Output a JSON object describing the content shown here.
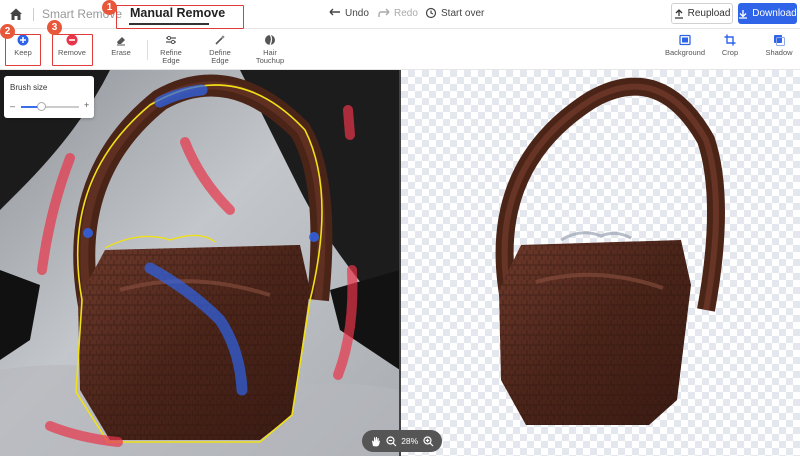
{
  "header": {
    "tab_smart": "Smart Remove",
    "tab_manual": "Manual Remove",
    "undo": "Undo",
    "redo": "Redo",
    "start_over": "Start over",
    "reupload": "Reupload",
    "download": "Download"
  },
  "toolbar": {
    "keep": "Keep",
    "remove": "Remove",
    "erase": "Erase",
    "refine_edge": [
      "Refine",
      "Edge"
    ],
    "define_edge": [
      "Define",
      "Edge"
    ],
    "hair_touchup": [
      "Hair",
      "Touchup"
    ],
    "background": "Background",
    "crop": "Crop",
    "shadow": "Shadow"
  },
  "brush": {
    "label": "Brush size",
    "minus": "–",
    "plus": "+",
    "level": 0.35
  },
  "zoom": {
    "value": "28%"
  },
  "annotations": [
    "1",
    "2",
    "3"
  ],
  "colors": {
    "accent": "#2f64e8",
    "highlight": "#e03c3c",
    "badge": "#e8573a",
    "keep": "#2f64e8",
    "remove": "#e8354a"
  },
  "icons": [
    "home-icon",
    "undo-icon",
    "redo-icon",
    "history-icon",
    "upload-icon",
    "download-icon",
    "plus-circle-icon",
    "minus-circle-icon",
    "eraser-icon",
    "sliders-icon",
    "wand-icon",
    "hair-icon",
    "background-icon",
    "crop-icon",
    "shadow-icon",
    "hand-icon",
    "zoom-out-icon",
    "zoom-in-icon"
  ]
}
